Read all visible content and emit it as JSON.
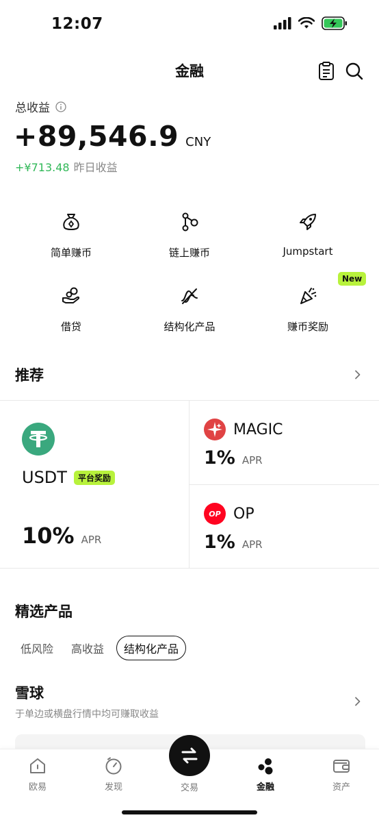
{
  "status_bar": {
    "time": "12:07"
  },
  "header": {
    "title": "金融",
    "icons": [
      "clipboard-icon",
      "search-icon"
    ]
  },
  "earnings": {
    "label": "总收益",
    "amount": "+89,546.9",
    "currency": "CNY",
    "yesterday_value": "+¥713.48",
    "yesterday_label": "昨日收益"
  },
  "quick_actions": [
    {
      "label": "简单赚币",
      "icon": "money-bag-icon"
    },
    {
      "label": "链上赚币",
      "icon": "chain-nodes-icon"
    },
    {
      "label": "Jumpstart",
      "icon": "rocket-icon"
    },
    {
      "label": "借贷",
      "icon": "hand-coins-icon"
    },
    {
      "label": "结构化产品",
      "icon": "structured-product-icon"
    },
    {
      "label": "赚币奖励",
      "icon": "party-popper-icon",
      "badge": "New"
    }
  ],
  "recommend": {
    "title": "推荐",
    "main": {
      "name": "USDT",
      "badge": "平台奖励",
      "rate": "10%",
      "apr": "APR",
      "icon_color": "#3aa87e"
    },
    "items": [
      {
        "name": "MAGIC",
        "rate": "1%",
        "apr": "APR",
        "icon_color": "#e04344"
      },
      {
        "name": "OP",
        "rate": "1%",
        "apr": "APR",
        "icon_color": "#ff0420",
        "icon_text": "OP"
      }
    ]
  },
  "featured": {
    "title": "精选产品",
    "filters": [
      "低风险",
      "高收益",
      "结构化产品"
    ],
    "active_filter": "结构化产品",
    "product_title": "雪球",
    "product_desc": "于单边或横盘行情中均可赚取收益"
  },
  "bottom_nav": {
    "items": [
      {
        "label": "欧易",
        "icon": "home-icon"
      },
      {
        "label": "发现",
        "icon": "discover-icon"
      },
      {
        "label": "交易",
        "icon": "trade-swap-icon"
      },
      {
        "label": "金融",
        "icon": "finance-icon",
        "active": true
      },
      {
        "label": "资产",
        "icon": "wallet-icon"
      }
    ]
  },
  "colors": {
    "accent_green": "#31b858",
    "badge_lime": "#b8f23c"
  }
}
